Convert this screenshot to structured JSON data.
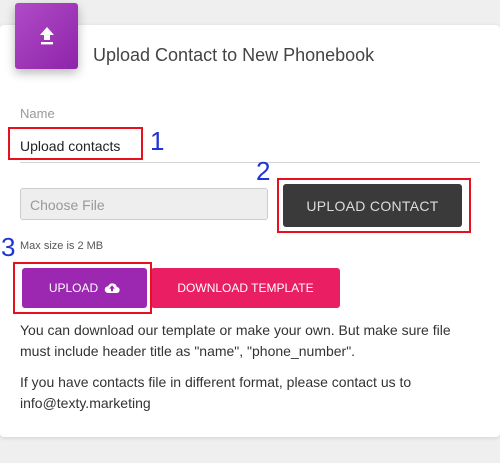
{
  "header": {
    "title": "Upload Contact to New Phonebook"
  },
  "form": {
    "name_label": "Name",
    "name_value": "Upload contacts",
    "file_placeholder": "Choose File",
    "upload_contact_label": "UPLOAD CONTACT",
    "max_size_note": "Max size is 2 MB",
    "upload_label": "UPLOAD",
    "download_template_label": "DOWNLOAD TEMPLATE"
  },
  "info": {
    "paragraph_1": "You can download our template or make your own. But make sure file must include header title as \"name\", \"phone_number\".",
    "paragraph_2": "If you have contacts file in different format, please contact us to info@texty.marketing"
  },
  "annotations": {
    "n1": "1",
    "n2": "2",
    "n3": "3"
  },
  "icons": {
    "header_icon": "upload-arrow-icon",
    "upload_button_icon": "cloud-upload-icon"
  },
  "colors": {
    "accent_purple": "#9c27b0",
    "accent_pink": "#e91e63",
    "dark_button": "#3a3a3a",
    "annotation_red": "#e8101e",
    "annotation_blue": "#1f33d6"
  }
}
